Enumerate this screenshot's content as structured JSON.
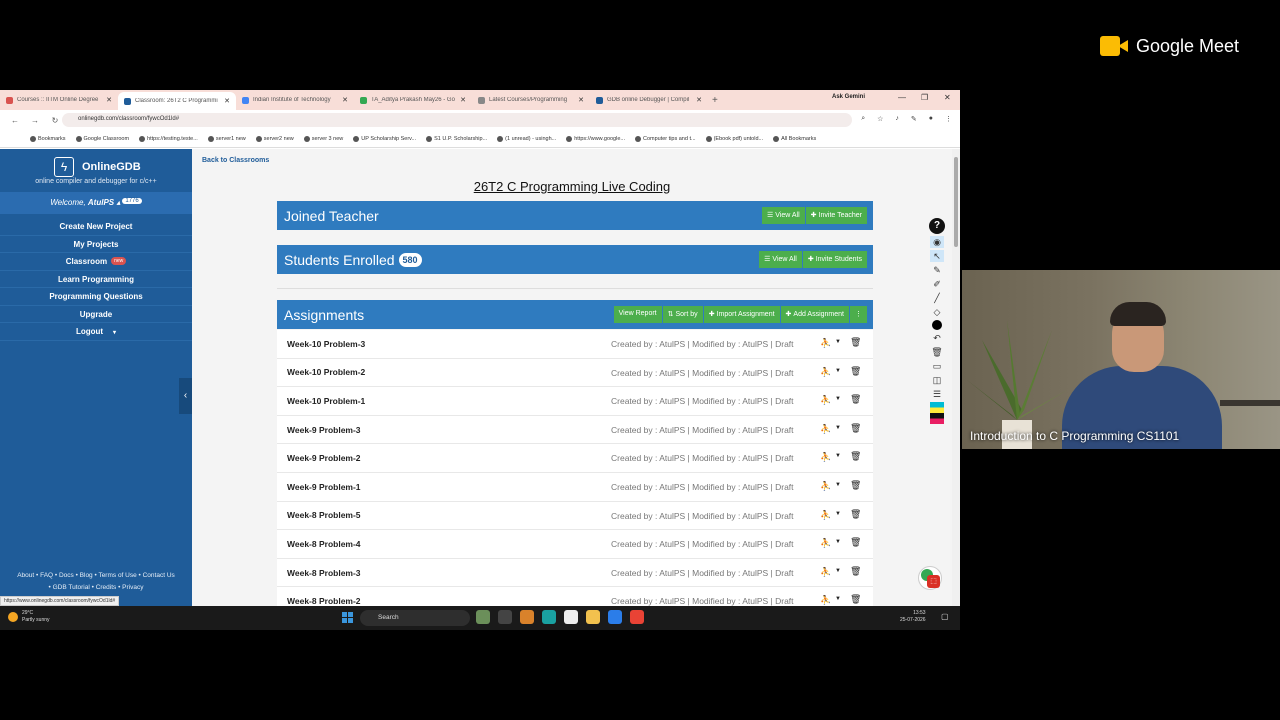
{
  "meet": {
    "brand": "Google Meet",
    "speaker_caption": "Introduction to C Programming CS1101"
  },
  "browser": {
    "tabs": [
      {
        "label": "Courses :: IITM Online Degree",
        "color": "#d9534f",
        "active": false
      },
      {
        "label": "Classroom: 26T2 C Programmi",
        "color": "#1f5c99",
        "active": true
      },
      {
        "label": "Indian Institute of Technology",
        "color": "#4285f4",
        "active": false
      },
      {
        "label": "TA_Aditya Prakash May26 - Go",
        "color": "#34a853",
        "active": false
      },
      {
        "label": "Latest Courses/Programming",
        "color": "#888888",
        "active": false
      },
      {
        "label": "GDB online Debugger | Compil",
        "color": "#1f5c99",
        "active": false
      }
    ],
    "new_tab": "+",
    "ask_gemini": "Ask Gemini",
    "url": "onlinegdb.com/classroom/fywcOd1ld#",
    "bookmarks": [
      "Bookmarks",
      "Google Classroom",
      "https://testing.teste...",
      "server1 new",
      "server2 new",
      "server 3 new",
      "UP Scholarship Serv...",
      "S1 U.P. Scholarship...",
      "(1 unread) - usingh...",
      "https://www.google...",
      "Computer tips and t...",
      "(Ebook pdf) untold...",
      "All Bookmarks"
    ]
  },
  "sidebar": {
    "brand": "OnlineGDB",
    "tagline": "online compiler and debugger for c/c++",
    "welcome_prefix": "Welcome, ",
    "user": "AtulPS",
    "karma": "1776",
    "menu": [
      {
        "label": "Create New Project"
      },
      {
        "label": "My Projects"
      },
      {
        "label": "Classroom",
        "badge": "new"
      },
      {
        "label": "Learn Programming"
      },
      {
        "label": "Programming Questions"
      },
      {
        "label": "Upgrade"
      },
      {
        "label": "Logout",
        "caret": "▾"
      }
    ],
    "footer_line1": "About • FAQ • Docs • Blog • Terms of Use • Contact Us",
    "footer_line2": "• GDB Tutorial • Credits • Privacy",
    "status_url": "https://www.onlinegdb.com/classroom/fywcOd1ld#"
  },
  "main": {
    "back_link": "Back to Classrooms",
    "classroom_title": "26T2 C Programming Live Coding",
    "joined_teacher": {
      "title": "Joined Teacher",
      "view_all": "View All",
      "invite": "Invite Teacher"
    },
    "students": {
      "title": "Students Enrolled",
      "count": "580",
      "view_all": "View All",
      "invite": "Invite Students"
    },
    "assignments": {
      "title": "Assignments",
      "view_report": "View Report",
      "sort_by": "Sort by",
      "import": "Import Assignment",
      "add": "Add Assignment",
      "more": "⋮",
      "rows": [
        {
          "name": "Week-10 Problem-3",
          "meta": "Created by : AtulPS | Modified by : AtulPS | Draft"
        },
        {
          "name": "Week-10 Problem-2",
          "meta": "Created by : AtulPS | Modified by : AtulPS | Draft"
        },
        {
          "name": "Week-10 Problem-1",
          "meta": "Created by : AtulPS | Modified by : AtulPS | Draft"
        },
        {
          "name": "Week-9 Problem-3",
          "meta": "Created by : AtulPS | Modified by : AtulPS | Draft"
        },
        {
          "name": "Week-9 Problem-2",
          "meta": "Created by : AtulPS | Modified by : AtulPS | Draft"
        },
        {
          "name": "Week-9 Problem-1",
          "meta": "Created by : AtulPS | Modified by : AtulPS | Draft"
        },
        {
          "name": "Week-8 Problem-5",
          "meta": "Created by : AtulPS | Modified by : AtulPS | Draft"
        },
        {
          "name": "Week-8 Problem-4",
          "meta": "Created by : AtulPS | Modified by : AtulPS | Draft"
        },
        {
          "name": "Week-8 Problem-3",
          "meta": "Created by : AtulPS | Modified by : AtulPS | Draft"
        },
        {
          "name": "Week-8 Problem-2",
          "meta": "Created by : AtulPS | Modified by : AtulPS | Draft"
        }
      ]
    }
  },
  "taskbar": {
    "weather_temp": "29°C",
    "weather_desc": "Partly sunny",
    "search": "Search",
    "time": "13:53",
    "date": "25-07-2026"
  }
}
